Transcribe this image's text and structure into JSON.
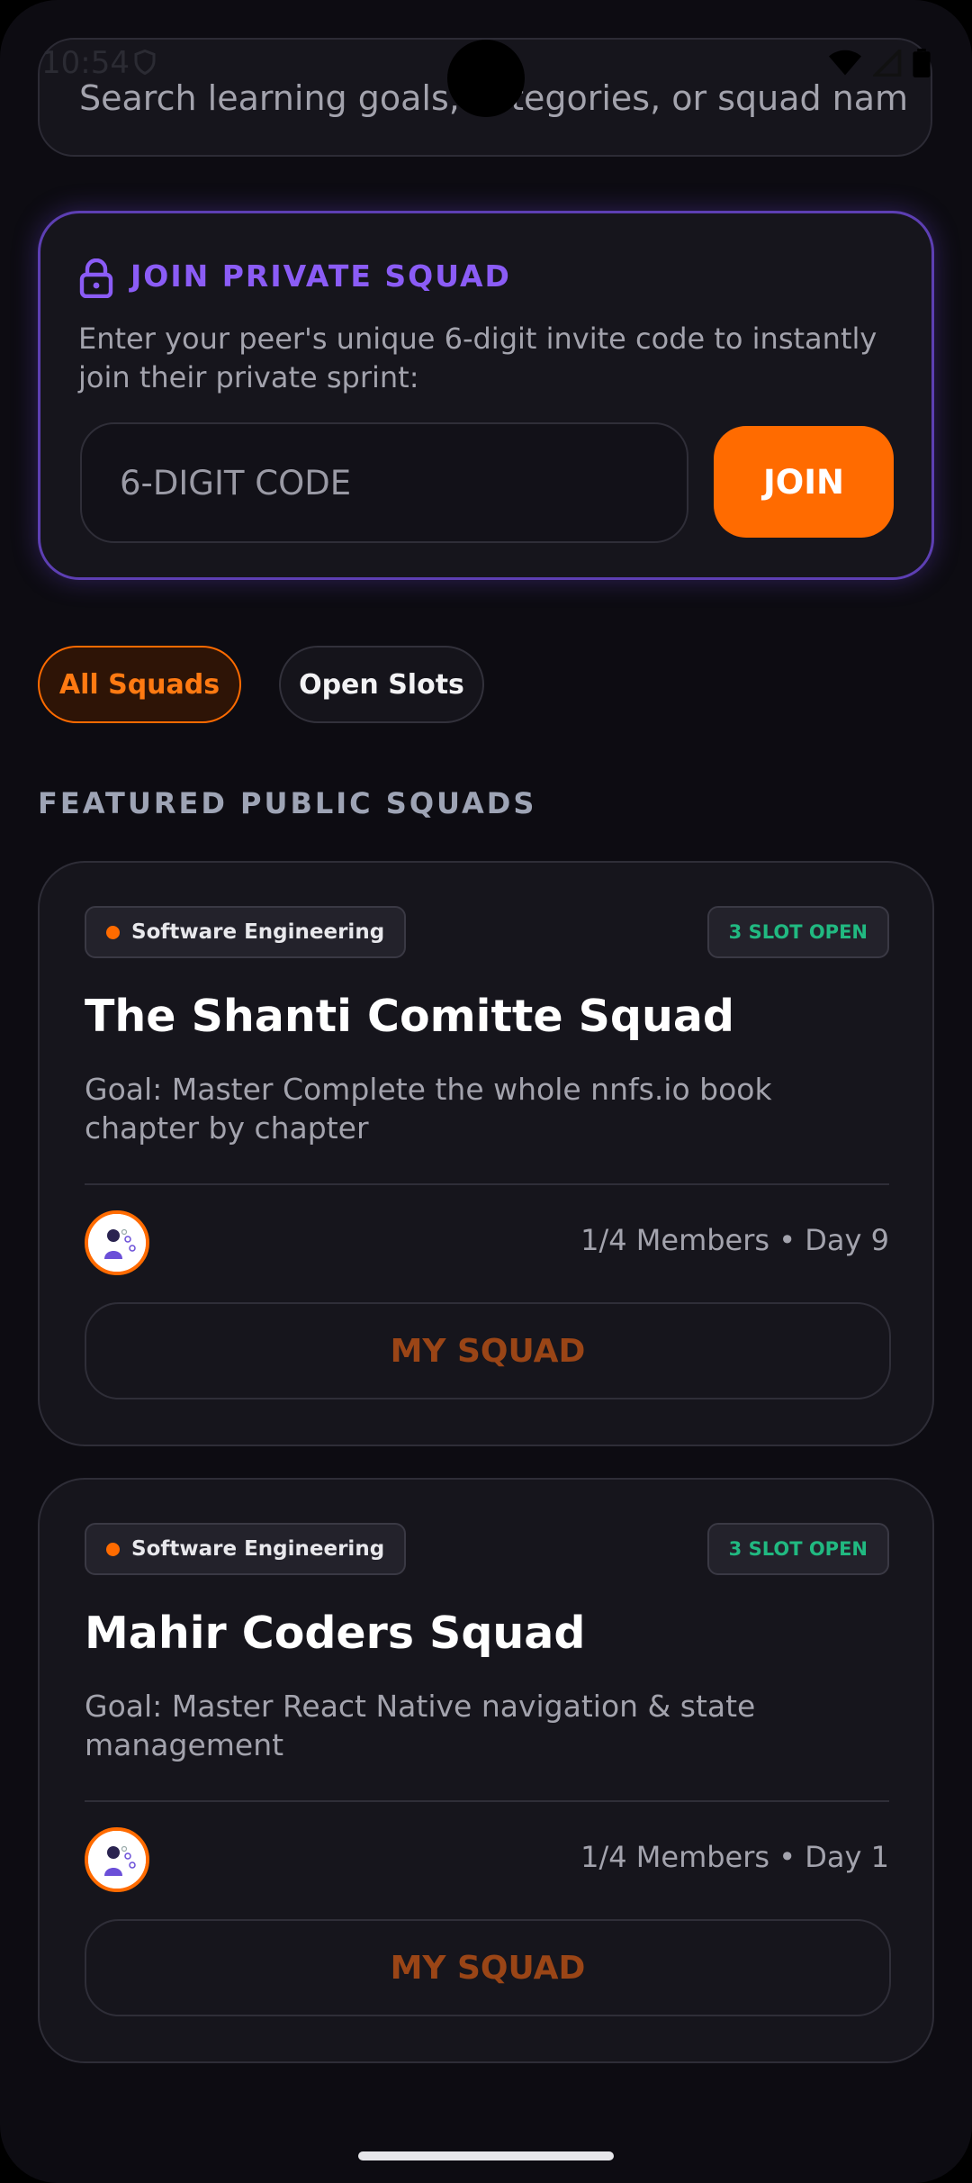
{
  "status_bar": {
    "time": "10:54"
  },
  "search": {
    "placeholder": "Search learning goals, categories, or squad nam"
  },
  "private_squad": {
    "title": "JOIN PRIVATE SQUAD",
    "description": "Enter your peer's unique 6-digit invite code to instantly join their private sprint:",
    "code_placeholder": "6-DIGIT CODE",
    "join_label": "JOIN",
    "accent_color": "#8b5cf6"
  },
  "filters": [
    {
      "label": "All Squads",
      "selected": true
    },
    {
      "label": "Open Slots",
      "selected": false
    }
  ],
  "section_title": "FEATURED PUBLIC SQUADS",
  "squads": [
    {
      "category": "Software Engineering",
      "slots": "3 SLOT OPEN",
      "name": "The Shanti Comitte Squad",
      "goal": "Goal: Master Complete the whole nnfs.io book chapter by chapter",
      "meta": "1/4 Members • Day 9",
      "button_label": "MY SQUAD"
    },
    {
      "category": "Software Engineering",
      "slots": "3 SLOT OPEN",
      "name": "Mahir Coders Squad",
      "goal": "Goal: Master React Native navigation & state management",
      "meta": "1/4 Members • Day 1",
      "button_label": "MY SQUAD"
    }
  ],
  "colors": {
    "brand_orange": "#ff6b00",
    "open_green": "#21b981",
    "background": "#0d0c12"
  }
}
